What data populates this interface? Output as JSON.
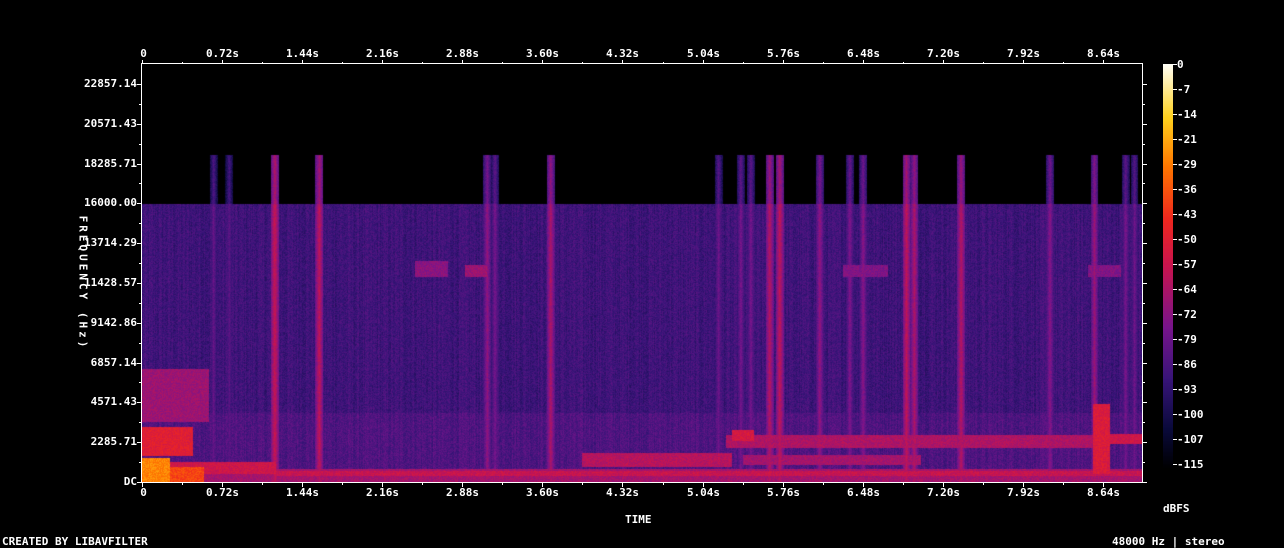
{
  "chart_data": {
    "type": "heatmap",
    "xlabel": "TIME",
    "ylabel": "FREQUENCY (Hz)",
    "x_ticks": [
      "0",
      "0.72s",
      "1.44s",
      "2.16s",
      "2.88s",
      "3.60s",
      "4.32s",
      "5.04s",
      "5.76s",
      "6.48s",
      "7.20s",
      "7.92s",
      "8.64s"
    ],
    "x_tick_values": [
      0,
      0.72,
      1.44,
      2.16,
      2.88,
      3.6,
      4.32,
      5.04,
      5.76,
      6.48,
      7.2,
      7.92,
      8.64
    ],
    "xlim": [
      0,
      9.0
    ],
    "y_ticks": [
      "DC",
      "2285.71",
      "4571.43",
      "6857.14",
      "9142.86",
      "11428.57",
      "13714.29",
      "16000.00",
      "18285.71",
      "20571.43",
      "22857.14"
    ],
    "y_tick_values": [
      0,
      2285.71,
      4571.43,
      6857.14,
      9142.86,
      11428.57,
      13714.29,
      16000,
      18285.71,
      20571.43,
      22857.14
    ],
    "ylim": [
      0,
      24000
    ],
    "colorbar_ticks": [
      "0",
      "-7",
      "-14",
      "-21",
      "-29",
      "-36",
      "-43",
      "-50",
      "-57",
      "-64",
      "-72",
      "-79",
      "-86",
      "-93",
      "-100",
      "-107",
      "-115"
    ],
    "colorbar_values": [
      0,
      -7,
      -14,
      -21,
      -29,
      -36,
      -43,
      -50,
      -57,
      -64,
      -72,
      -79,
      -86,
      -93,
      -100,
      -107,
      -115
    ],
    "colorbar_label": "dBFS",
    "colorbar_range": [
      -120,
      0
    ],
    "background_level_db": -92,
    "cutoff_hz": 16000,
    "transients": [
      {
        "t": 0.64,
        "db": -82,
        "above": true
      },
      {
        "t": 0.78,
        "db": -84,
        "above": true
      },
      {
        "t": 1.19,
        "db": -60,
        "above": true
      },
      {
        "t": 1.59,
        "db": -62,
        "above": true
      },
      {
        "t": 3.1,
        "db": -72,
        "above": true
      },
      {
        "t": 3.17,
        "db": -78,
        "above": true
      },
      {
        "t": 3.67,
        "db": -66,
        "above": true
      },
      {
        "t": 5.18,
        "db": -80,
        "above": true
      },
      {
        "t": 5.38,
        "db": -78,
        "above": true
      },
      {
        "t": 5.47,
        "db": -78,
        "above": true
      },
      {
        "t": 5.64,
        "db": -64,
        "above": true
      },
      {
        "t": 5.73,
        "db": -62,
        "above": true
      },
      {
        "t": 6.09,
        "db": -72,
        "above": true
      },
      {
        "t": 6.36,
        "db": -76,
        "above": true
      },
      {
        "t": 6.48,
        "db": -74,
        "above": true
      },
      {
        "t": 6.87,
        "db": -62,
        "above": true
      },
      {
        "t": 6.94,
        "db": -66,
        "above": true
      },
      {
        "t": 7.36,
        "db": -64,
        "above": true
      },
      {
        "t": 8.16,
        "db": -74,
        "above": true
      },
      {
        "t": 8.56,
        "db": -70,
        "above": true
      },
      {
        "t": 8.84,
        "db": -78,
        "above": true
      },
      {
        "t": 8.92,
        "db": -80,
        "above": true
      }
    ],
    "events": [
      {
        "t0": 0.0,
        "t1": 0.25,
        "f0": 0,
        "f1": 1400,
        "db": -28
      },
      {
        "t0": 0.0,
        "t1": 0.55,
        "f0": 0,
        "f1": 900,
        "db": -40
      },
      {
        "t0": 0.0,
        "t1": 0.45,
        "f0": 1500,
        "f1": 3200,
        "db": -52
      },
      {
        "t0": 0.0,
        "t1": 0.6,
        "f0": 3500,
        "f1": 6500,
        "db": -70
      },
      {
        "t0": 0.0,
        "t1": 1.2,
        "f0": 500,
        "f1": 1200,
        "db": -58
      },
      {
        "t0": 0.0,
        "t1": 9.0,
        "f0": 0,
        "f1": 800,
        "db": -68
      },
      {
        "t0": 1.2,
        "t1": 9.0,
        "f0": 400,
        "f1": 650,
        "db": -60
      },
      {
        "t0": 3.95,
        "t1": 5.3,
        "f0": 900,
        "f1": 1700,
        "db": -64
      },
      {
        "t0": 5.25,
        "t1": 8.6,
        "f0": 2000,
        "f1": 2700,
        "db": -66
      },
      {
        "t0": 5.3,
        "t1": 5.5,
        "f0": 2400,
        "f1": 3000,
        "db": -56
      },
      {
        "t0": 5.4,
        "t1": 7.0,
        "f0": 1000,
        "f1": 1600,
        "db": -68
      },
      {
        "t0": 8.6,
        "t1": 9.0,
        "f0": 2200,
        "f1": 2800,
        "db": -58
      },
      {
        "t0": 8.55,
        "t1": 8.7,
        "f0": 500,
        "f1": 4500,
        "db": -54
      },
      {
        "t0": 2.45,
        "t1": 2.75,
        "f0": 11800,
        "f1": 12700,
        "db": -74
      },
      {
        "t0": 2.9,
        "t1": 3.1,
        "f0": 11800,
        "f1": 12500,
        "db": -70
      },
      {
        "t0": 6.3,
        "t1": 6.7,
        "f0": 11800,
        "f1": 12500,
        "db": -76
      },
      {
        "t0": 8.5,
        "t1": 8.8,
        "f0": 11800,
        "f1": 12500,
        "db": -76
      }
    ]
  },
  "footer": {
    "credit": "CREATED BY LIBAVFILTER",
    "info": "48000 Hz | stereo"
  },
  "colors": {
    "background": "#000000",
    "axis": "#ffffff"
  }
}
